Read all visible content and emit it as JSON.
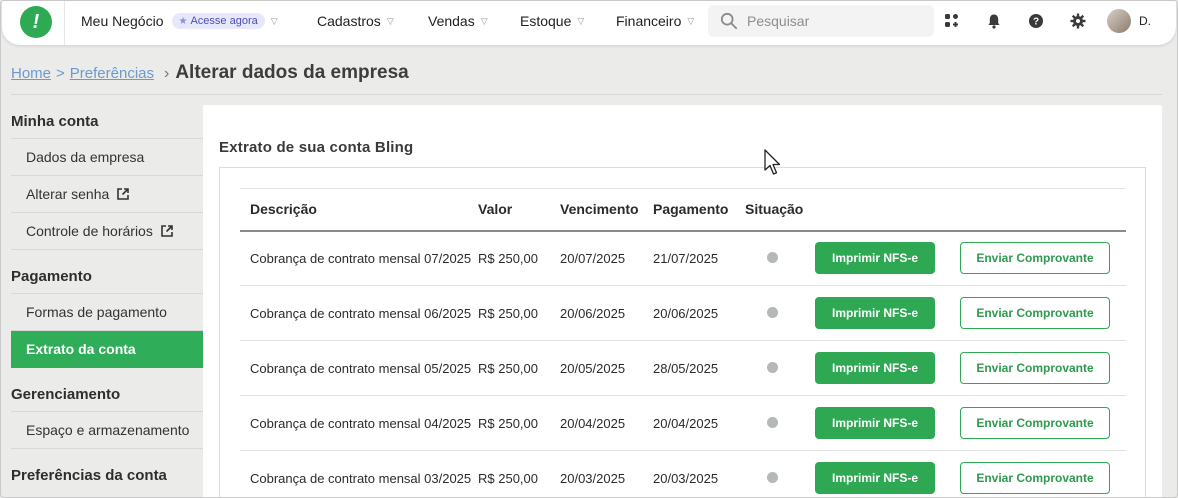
{
  "header": {
    "business_name": "Meu Negócio",
    "badge_label": "Acesse agora",
    "nav": [
      {
        "label": "Cadastros"
      },
      {
        "label": "Vendas"
      },
      {
        "label": "Estoque"
      },
      {
        "label": "Financeiro"
      }
    ],
    "search_placeholder": "Pesquisar",
    "user_initial": "D.",
    "icons": [
      "apps-icon",
      "bell-icon",
      "help-icon",
      "gear-icon"
    ],
    "brand_color": "#2eaa55"
  },
  "breadcrumb": {
    "home": "Home",
    "separator": ">",
    "preferences": "Preferências",
    "title": "Alterar dados da empresa"
  },
  "sidebar": {
    "sections": [
      {
        "title": "Minha conta",
        "items": [
          {
            "label": "Dados da empresa",
            "external": false,
            "active": false
          },
          {
            "label": "Alterar senha",
            "external": true,
            "active": false
          },
          {
            "label": "Controle de horários",
            "external": true,
            "active": false
          }
        ]
      },
      {
        "title": "Pagamento",
        "items": [
          {
            "label": "Formas de pagamento",
            "external": false,
            "active": false
          },
          {
            "label": "Extrato da conta",
            "external": false,
            "active": true
          }
        ]
      },
      {
        "title": "Gerenciamento",
        "items": [
          {
            "label": "Espaço e armazenamento",
            "external": false,
            "active": false
          }
        ]
      },
      {
        "title": "Preferências da conta",
        "items": []
      }
    ]
  },
  "main": {
    "title": "Extrato de sua conta Bling",
    "columns": [
      "Descrição",
      "Valor",
      "Vencimento",
      "Pagamento",
      "Situação"
    ],
    "rows": [
      {
        "descricao": "Cobrança de contrato mensal 07/2025",
        "valor": "R$ 250,00",
        "vencimento": "20/07/2025",
        "pagamento": "21/07/2025"
      },
      {
        "descricao": "Cobrança de contrato mensal 06/2025",
        "valor": "R$ 250,00",
        "vencimento": "20/06/2025",
        "pagamento": "20/06/2025"
      },
      {
        "descricao": "Cobrança de contrato mensal 05/2025",
        "valor": "R$ 250,00",
        "vencimento": "20/05/2025",
        "pagamento": "28/05/2025"
      },
      {
        "descricao": "Cobrança de contrato mensal 04/2025",
        "valor": "R$ 250,00",
        "vencimento": "20/04/2025",
        "pagamento": "20/04/2025"
      },
      {
        "descricao": "Cobrança de contrato mensal 03/2025",
        "valor": "R$ 250,00",
        "vencimento": "20/03/2025",
        "pagamento": "20/03/2025"
      }
    ],
    "print_button_label": "Imprimir NFS-e",
    "send_button_label": "Enviar Comprovante",
    "status_color": "#b5b8b8"
  }
}
